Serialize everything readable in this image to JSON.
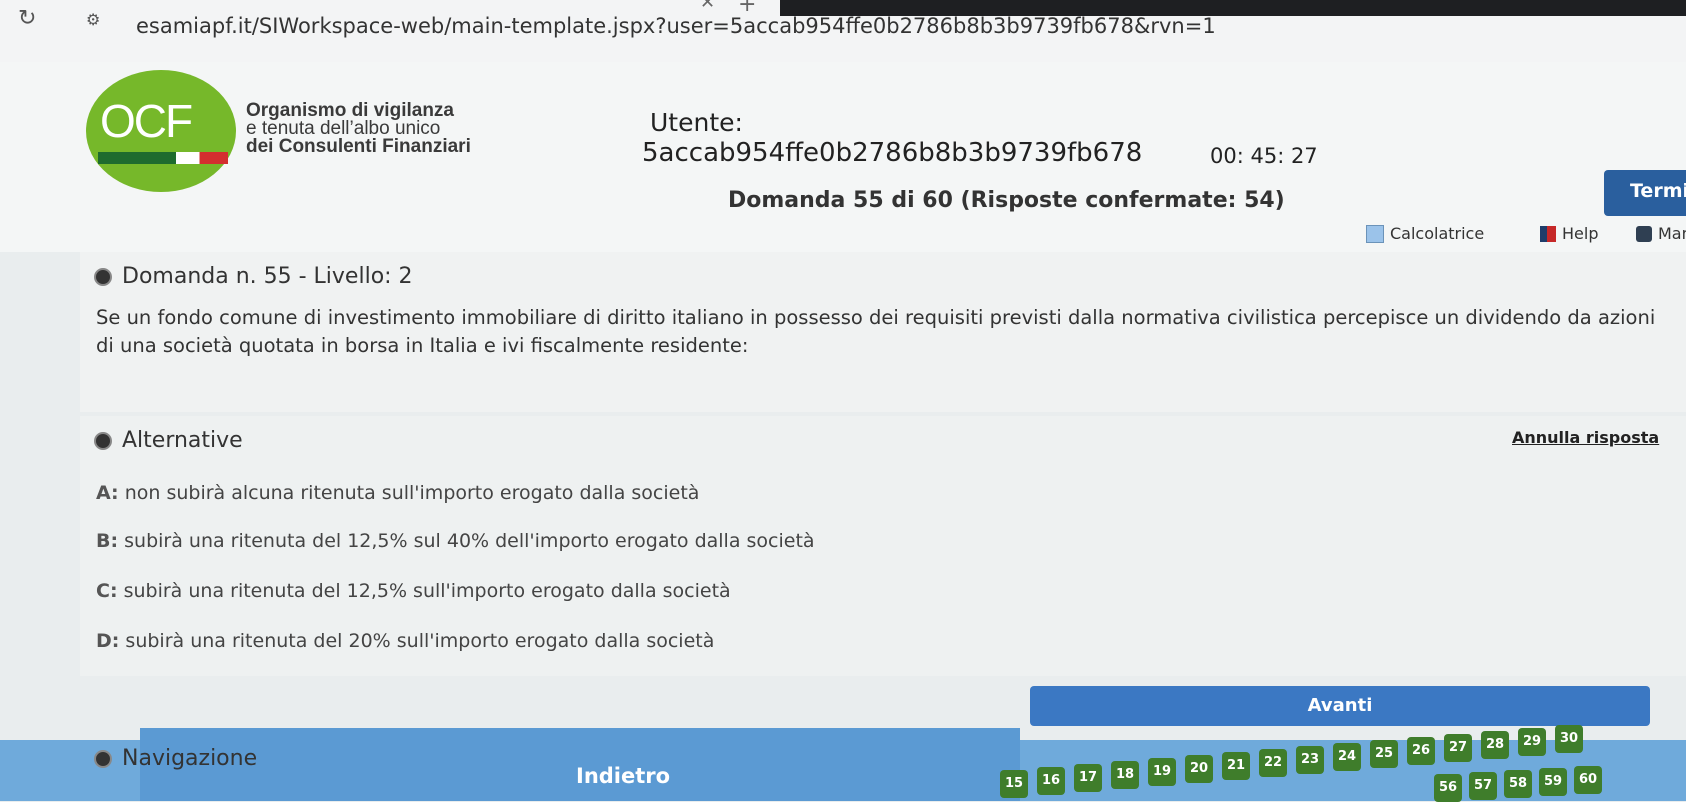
{
  "browser": {
    "url": "esamiapf.it/SIWorkspace-web/main-template.jspx?user=5accab954ffe0b2786b8b3b9739fb678&rvn=1"
  },
  "header": {
    "logo_text": "OCF",
    "org_line1": "Organismo di vigilanza",
    "org_line2": "e tenuta dell’albo unico",
    "org_line3": "dei Consulenti Finanziari",
    "user_label": "Utente:",
    "user_id": "5accab954ffe0b2786b8b3b9739fb678",
    "timer": "00: 45: 27",
    "question_counter": "Domanda 55 di 60 (Risposte confermate: 54)",
    "termina_label": "Termir",
    "tools": {
      "calc": "Calcolatrice",
      "help": "Help",
      "manual": "Manu"
    }
  },
  "question": {
    "title": "Domanda n. 55 - Livello: 2",
    "text": "Se un fondo comune di investimento immobiliare di diritto italiano in possesso dei requisiti previsti dalla normativa civilistica percepisce un dividendo da azioni di una società quotata in borsa in Italia e ivi fiscalmente residente:"
  },
  "alternatives": {
    "title": "Alternative",
    "cancel": "Annulla risposta",
    "items": [
      {
        "letter": "A:",
        "text": "non subirà alcuna ritenuta sull'importo erogato dalla società"
      },
      {
        "letter": "B:",
        "text": "subirà una ritenuta del 12,5% sul 40% dell'importo erogato dalla società"
      },
      {
        "letter": "C:",
        "text": "subirà una ritenuta del 12,5% sull'importo erogato dalla società"
      },
      {
        "letter": "D:",
        "text": "subirà una ritenuta del 20% sull'importo erogato dalla società"
      }
    ]
  },
  "navigation": {
    "title": "Navigazione",
    "back": "Indietro",
    "next": "Avanti",
    "row1": [
      "15",
      "16",
      "17",
      "18",
      "19",
      "20",
      "21",
      "22",
      "23",
      "24",
      "25",
      "26",
      "27",
      "28",
      "29",
      "30"
    ],
    "row2": [
      "56",
      "57",
      "58",
      "59",
      "60"
    ]
  }
}
